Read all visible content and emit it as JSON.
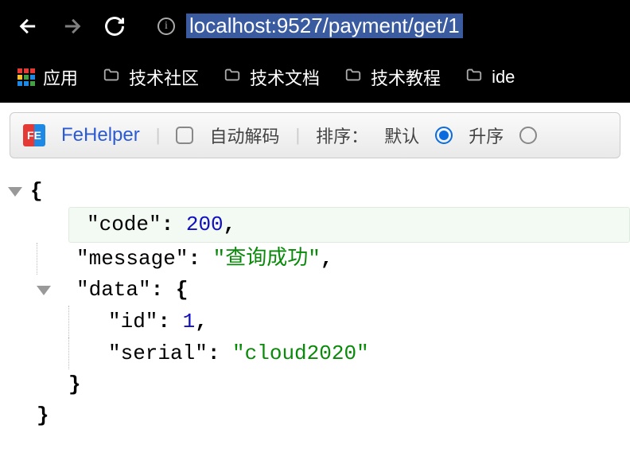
{
  "nav": {
    "url": "localhost:9527/payment/get/1"
  },
  "bookmarks": {
    "apps_label": "应用",
    "items": [
      "技术社区",
      "技术文档",
      "技术教程",
      "ide"
    ]
  },
  "toolbar": {
    "app_name": "FeHelper",
    "auto_decode_label": "自动解码",
    "sort_label": "排序：",
    "sort_default": "默认",
    "sort_asc": "升序"
  },
  "json": {
    "open_brace": "{",
    "code_key": "\"code\"",
    "code_val": "200",
    "message_key": "\"message\"",
    "message_val": "\"查询成功\"",
    "data_key": "\"data\"",
    "data_open": "{",
    "id_key": "\"id\"",
    "id_val": "1",
    "serial_key": "\"serial\"",
    "serial_val": "\"cloud2020\"",
    "data_close": "}",
    "close_brace": "}",
    "colon": ": ",
    "comma": ","
  }
}
